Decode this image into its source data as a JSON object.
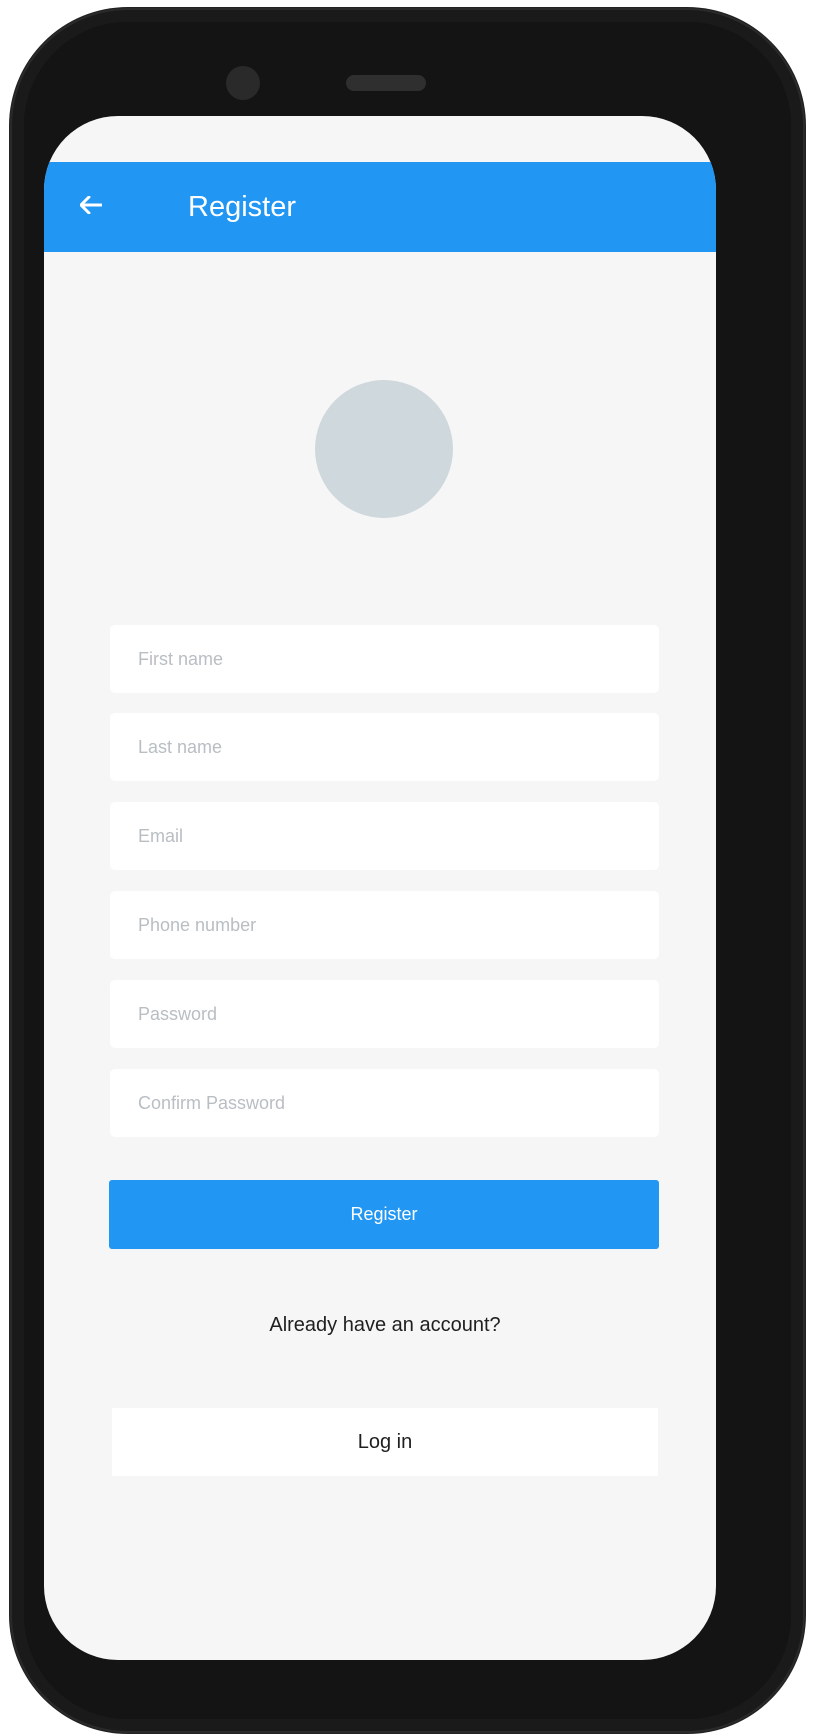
{
  "appbar": {
    "title": "Register",
    "back_icon": "arrow-left-icon",
    "color": "#2196f3"
  },
  "avatar": {
    "icon": "profile-placeholder",
    "color": "#cfd8dc"
  },
  "form": {
    "first_name_placeholder": "First name",
    "last_name_placeholder": "Last name",
    "email_placeholder": "Email",
    "phone_placeholder": "Phone number",
    "password_placeholder": "Password",
    "confirm_password_placeholder": "Confirm Password",
    "first_name_value": "",
    "last_name_value": "",
    "email_value": "",
    "phone_value": "",
    "password_value": "",
    "confirm_password_value": ""
  },
  "actions": {
    "register_label": "Register",
    "already_account_text": "Already have an account?",
    "login_label": "Log in"
  },
  "colors": {
    "primary": "#2196f3",
    "background": "#f6f6f6",
    "field_background": "#ffffff"
  }
}
